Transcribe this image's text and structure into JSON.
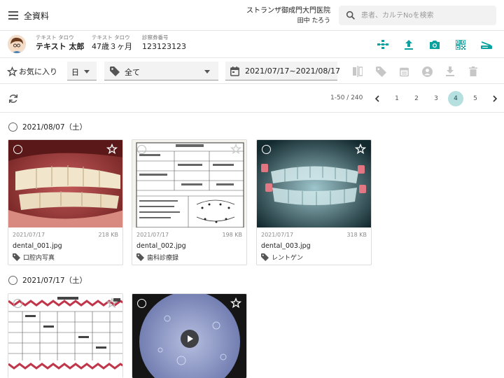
{
  "header": {
    "title": "全資料",
    "clinic_name": "ストランザ御成門大門医院",
    "user_name": "田中 たろう",
    "search_placeholder": "患者、カルテNoを検索"
  },
  "patient": {
    "name_kana_label": "テキスト タロウ",
    "name": "テキスト 太郎",
    "age_kana_label": "テキスト タロウ",
    "age": "47歳３ヶ月",
    "card_no_label": "診察券番号",
    "card_no": "123123123",
    "tool_icons": [
      "tree-icon",
      "upload-icon",
      "camera-icon",
      "qr-code-icon",
      "scanner-icon"
    ]
  },
  "filter": {
    "favorite_label": "お気に入り",
    "period": "日",
    "tag": "全て",
    "date_range": "2021/07/17~2021/08/17"
  },
  "pagination": {
    "range": "1-50 / 240",
    "pages": [
      "1",
      "2",
      "3",
      "4",
      "5"
    ],
    "current": "4"
  },
  "groups": [
    {
      "date": "2021/08/07（土）",
      "items": [
        {
          "date": "2021/07/17",
          "size": "218 KB",
          "file": "dental_001.jpg",
          "tag": "口腔内写真"
        },
        {
          "date": "2021/07/17",
          "size": "198 KB",
          "file": "dental_002.jpg",
          "tag": "歯科診療録"
        },
        {
          "date": "2021/07/17",
          "size": "318 KB",
          "file": "dental_003.jpg",
          "tag": "レントゲン"
        }
      ]
    },
    {
      "date": "2021/07/17（土）"
    }
  ],
  "colors": {
    "accent": "#0aa19e",
    "active_page": "#b6dfe0",
    "disabled": "#c7c7c7"
  }
}
